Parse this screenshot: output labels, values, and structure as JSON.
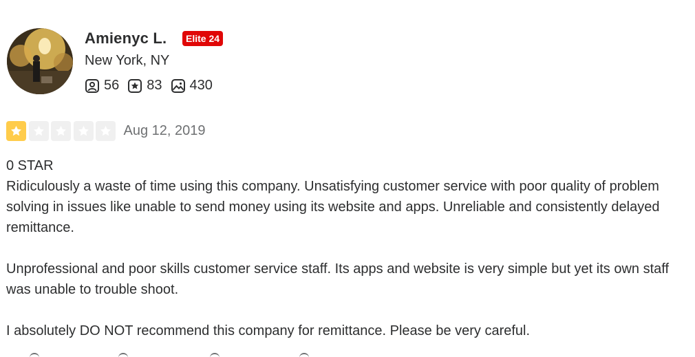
{
  "user": {
    "name": "Amienyc L.",
    "elite_badge": "Elite 24",
    "location": "New York, NY",
    "stats": [
      {
        "icon": "friends-icon",
        "value": "56"
      },
      {
        "icon": "reviews-icon",
        "value": "83"
      },
      {
        "icon": "photos-icon",
        "value": "430"
      }
    ]
  },
  "review": {
    "rating": 1,
    "max_rating": 5,
    "date": "Aug 12, 2019",
    "paragraphs": [
      "0 STAR",
      "Ridiculously a waste of time using this company. Unsatisfying customer service with poor quality of problem solving in issues like unable to send money using its website and apps. Unreliable and consistently delayed remittance.",
      "Unprofessional and poor skills customer service staff. Its apps and website is very simple but yet its own staff was unable to trouble shoot.",
      "I absolutely DO NOT recommend this company for remittance. Please be very careful."
    ]
  },
  "colors": {
    "star_filled": "#ffcc4b",
    "star_empty": "#f0f0f0",
    "elite_badge_bg": "#e00707",
    "text": "#2d2e2f",
    "muted": "#6e7072"
  }
}
